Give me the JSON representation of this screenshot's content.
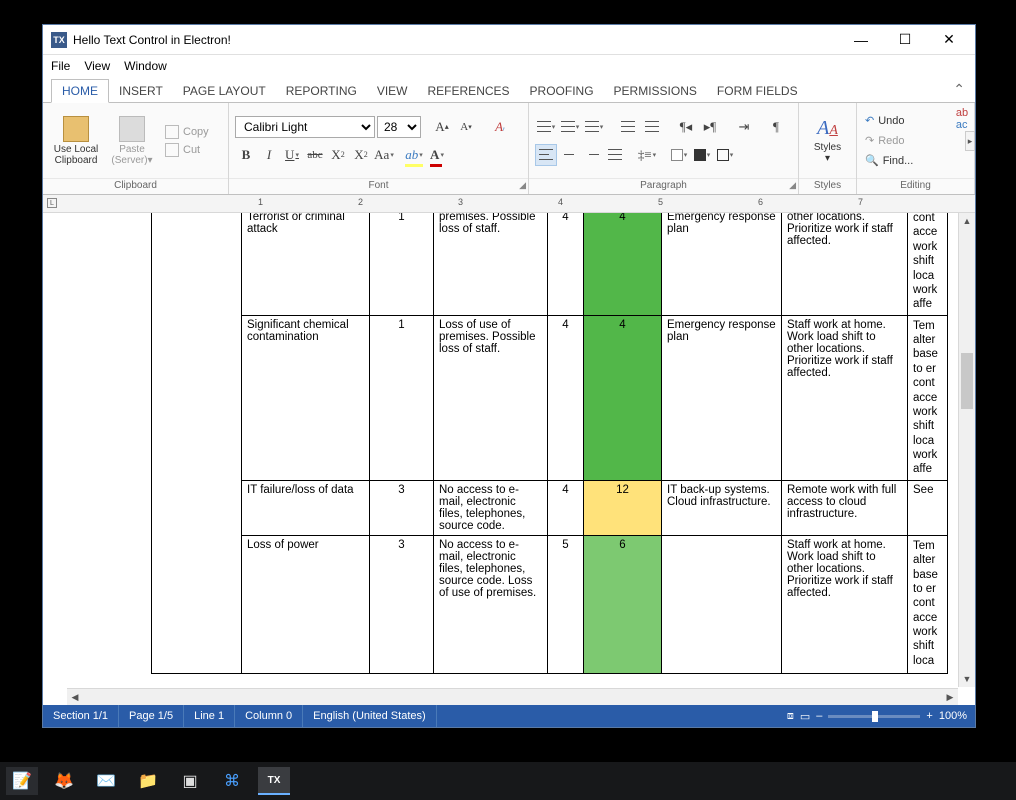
{
  "window": {
    "title": "Hello Text Control in Electron!",
    "logo": "TX"
  },
  "menu": {
    "file": "File",
    "view": "View",
    "window": "Window"
  },
  "tabs": {
    "home": "HOME",
    "insert": "INSERT",
    "pagelayout": "PAGE LAYOUT",
    "reporting": "REPORTING",
    "viewtab": "VIEW",
    "references": "REFERENCES",
    "proofing": "PROOFING",
    "permissions": "PERMISSIONS",
    "formfields": "FORM FIELDS"
  },
  "ribbon": {
    "clipboard": {
      "uselocal": "Use Local Clipboard",
      "paste": "Paste (Server)",
      "copy": "Copy",
      "cut": "Cut",
      "label": "Clipboard"
    },
    "font": {
      "name": "Calibri Light",
      "size": "28",
      "label": "Font"
    },
    "paragraph": {
      "label": "Paragraph"
    },
    "styles": {
      "btn": "Styles",
      "label": "Styles"
    },
    "editing": {
      "undo": "Undo",
      "redo": "Redo",
      "find": "Find...",
      "label": "Editing"
    }
  },
  "ruler": {
    "l": "L",
    "m1": "1",
    "m2": "2",
    "m3": "3",
    "m4": "4",
    "m5": "5",
    "m6": "6",
    "m7": "7"
  },
  "table": {
    "r1": {
      "risk": "Terrorist or criminal attack",
      "n1": "1",
      "desc": "premises. Possible loss of staff.",
      "n2": "4",
      "score": "4",
      "plan": "Emergency response plan",
      "mit": "other locations. Prioritize work if staff affected.",
      "last": "cont acce work shift loca work affe"
    },
    "r2": {
      "risk": "Significant chemical contamination",
      "n1": "1",
      "desc": "Loss of use of premises. Possible loss of staff.",
      "n2": "4",
      "score": "4",
      "plan": "Emergency response plan",
      "mit": "Staff work at home. Work load shift to other locations. Prioritize work if staff affected.",
      "last": "Tem alter base to er cont acce work shift loca work affe"
    },
    "r3": {
      "risk": "IT failure/loss of data",
      "n1": "3",
      "desc": "No access to e-mail, electronic files, telephones, source code.",
      "n2": "4",
      "score": "12",
      "plan": "IT back-up systems. Cloud infrastructure.",
      "mit": "Remote work with full access to cloud infrastructure.",
      "last": "See"
    },
    "r4": {
      "risk": "Loss of power",
      "n1": "3",
      "desc": "No access to e-mail, electronic files, telephones, source code. Loss of use of premises.",
      "n2": "5",
      "score": "6",
      "plan": "",
      "mit": "Staff work at home. Work load shift to other locations. Prioritize work if staff affected.",
      "last": "Tem alter base to er cont acce work shift loca"
    }
  },
  "status": {
    "section": "Section 1/1",
    "page": "Page 1/5",
    "line": "Line 1",
    "column": "Column 0",
    "lang": "English (United States)",
    "zoom": "100%"
  }
}
